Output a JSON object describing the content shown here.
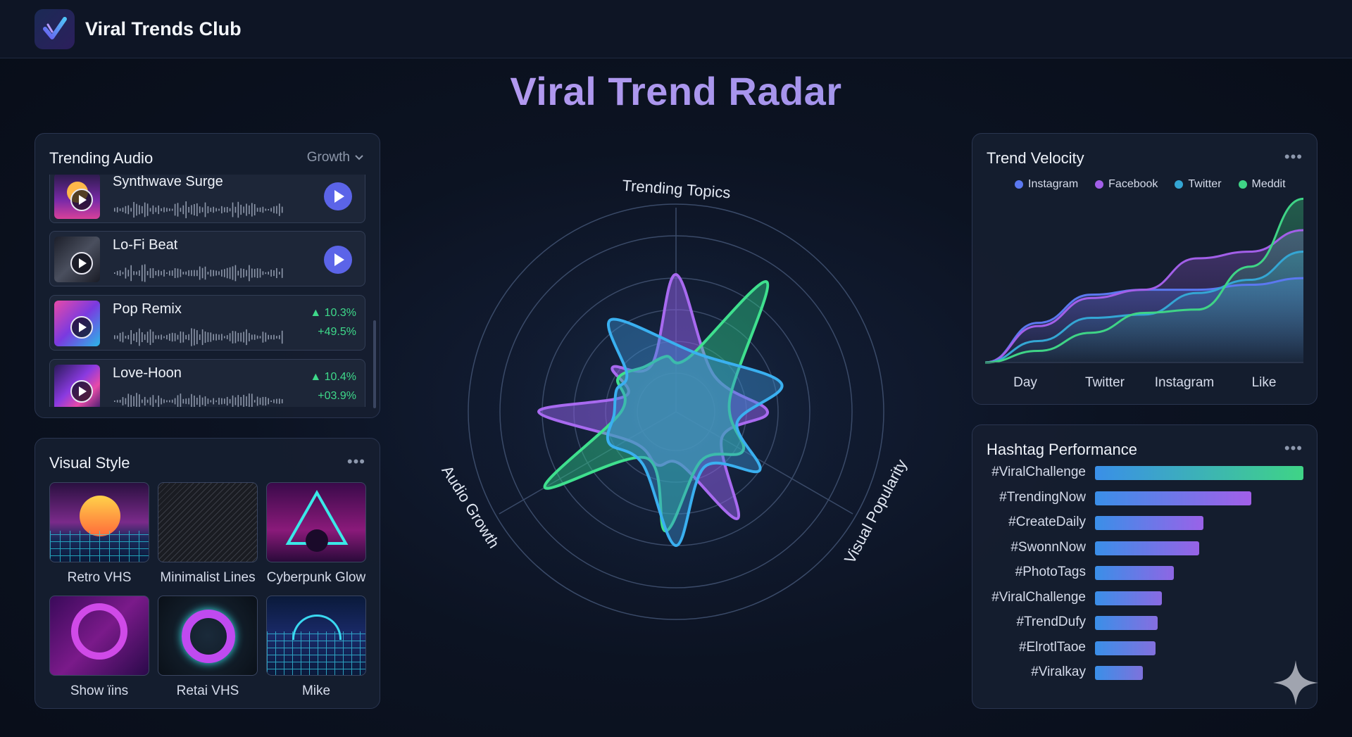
{
  "app": {
    "brand": "Viral Trends Club"
  },
  "page_title": "Viral Trend Radar",
  "trending_audio": {
    "title": "Trending Audio",
    "sort_label": "Growth",
    "items": [
      {
        "name": "Synthwave Surge",
        "action": "play"
      },
      {
        "name": "Lo-Fi Beat",
        "action": "play"
      },
      {
        "name": "Pop Remix",
        "change": "10.3%",
        "growth": "+49.5%"
      },
      {
        "name": "Love-Hoon",
        "change": "10.4%",
        "growth": "+03.9%"
      }
    ]
  },
  "visual_style": {
    "title": "Visual Style",
    "tiles": [
      {
        "label": "Retro VHS"
      },
      {
        "label": "Minimalist Lines"
      },
      {
        "label": "Cyberpunk Glow"
      },
      {
        "label": "Show ïins"
      },
      {
        "label": "Retai VHS"
      },
      {
        "label": "Mike"
      }
    ]
  },
  "radar": {
    "axes": [
      "Trending Topics",
      "Audio Growth",
      "Visual Popularity"
    ]
  },
  "trend_velocity": {
    "title": "Trend Velocity",
    "x_labels": [
      "Day",
      "Twitter",
      "Instagram",
      "Like"
    ],
    "chart_data": {
      "type": "area",
      "series": [
        {
          "name": "Instagram",
          "color": "#5b78f0",
          "values": [
            0,
            24,
            41,
            44,
            44,
            47,
            51
          ]
        },
        {
          "name": "Facebook",
          "color": "#a25fe8",
          "values": [
            0,
            22,
            39,
            44,
            63,
            67,
            80
          ]
        },
        {
          "name": "Twitter",
          "color": "#34a6d4",
          "values": [
            0,
            13,
            27,
            29,
            42,
            50,
            67
          ]
        },
        {
          "name": "Meddit",
          "color": "#3fd486",
          "values": [
            0,
            7,
            18,
            30,
            32,
            58,
            99
          ]
        }
      ]
    }
  },
  "hashtag_performance": {
    "title": "Hashtag Performance",
    "chart_data": {
      "type": "bar",
      "categories": [
        "#ViralChallenge",
        "#TrendingNow",
        "#CreateDaily",
        "#SwonnNow",
        "#PhotoTags",
        "#ViralChallenge",
        "#TrendDufy",
        "#ElrotlTaoe",
        "#Viralkay"
      ],
      "values": [
        100,
        75,
        52,
        50,
        38,
        32,
        30,
        29,
        23
      ],
      "colors": [
        "#3fd486",
        "#a25fe8",
        "#9a62e8",
        "#9762e6",
        "#8e66e4",
        "#8a6ae2",
        "#866ee0",
        "#8270de",
        "#7e72dc"
      ]
    }
  }
}
